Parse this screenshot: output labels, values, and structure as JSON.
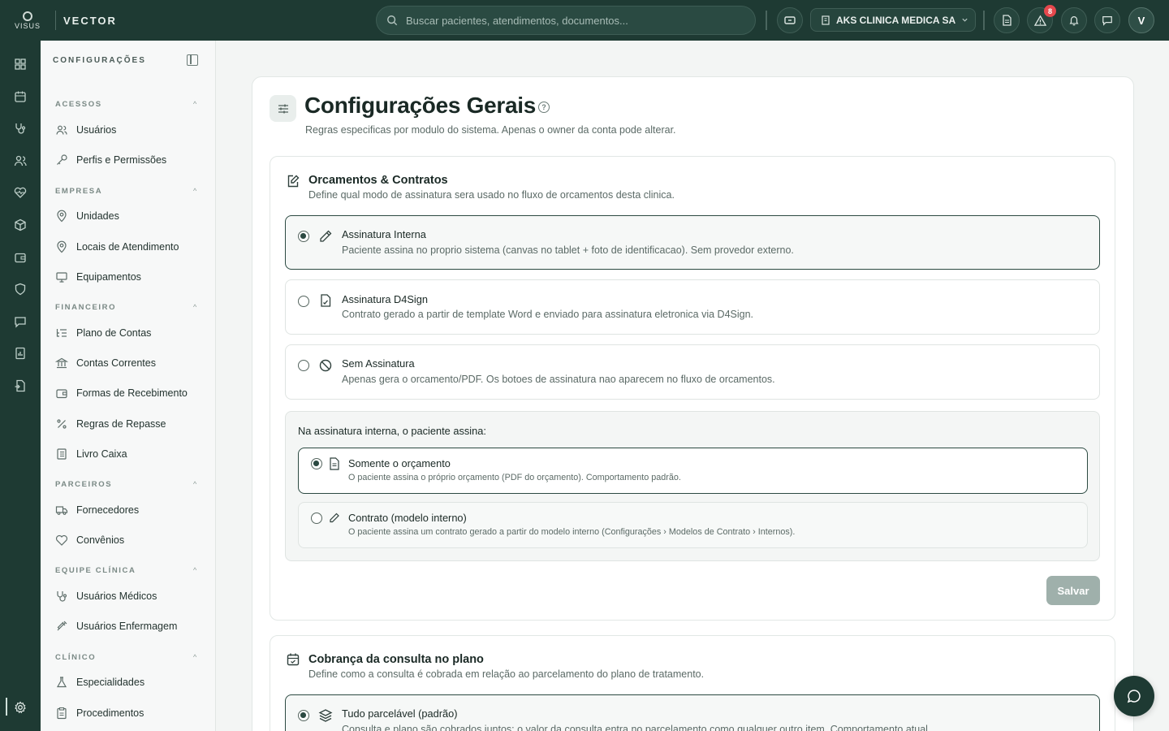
{
  "app": {
    "logo_text": "VISUS",
    "brand": "VECTOR"
  },
  "topbar": {
    "search_placeholder": "Buscar pacientes, atendimentos, documentos...",
    "clinic_name": "AKS CLINICA MEDICA SA",
    "alerts_count": "8",
    "avatar_initial": "V"
  },
  "sidebar": {
    "header": "CONFIGURAÇÕES",
    "sections": {
      "acessos": "ACESSOS",
      "empresa": "EMPRESA",
      "financeiro": "FINANCEIRO",
      "parceiros": "PARCEIROS",
      "equipe": "EQUIPE CLÍNICA",
      "clinico": "CLÍNICO"
    },
    "items": {
      "usuarios": "Usuários",
      "perfis": "Perfis e Permissões",
      "unidades": "Unidades",
      "locais": "Locais de Atendimento",
      "equipamentos": "Equipamentos",
      "plano_contas": "Plano de Contas",
      "contas_correntes": "Contas Correntes",
      "formas_recebimento": "Formas de Recebimento",
      "regras_repasse": "Regras de Repasse",
      "livro_caixa": "Livro Caixa",
      "fornecedores": "Fornecedores",
      "convenios": "Convênios",
      "usuarios_medicos": "Usuários Médicos",
      "usuarios_enfermagem": "Usuários Enfermagem",
      "especialidades": "Especialidades",
      "procedimentos": "Procedimentos"
    }
  },
  "page": {
    "title": "Configurações Gerais",
    "subtitle": "Regras especificas por modulo do sistema. Apenas o owner da conta pode alterar."
  },
  "orcamentos": {
    "title": "Orcamentos & Contratos",
    "desc": "Define qual modo de assinatura sera usado no fluxo de orcamentos desta clinica.",
    "options": [
      {
        "title": "Assinatura Interna",
        "desc": "Paciente assina no proprio sistema (canvas no tablet + foto de identificacao). Sem provedor externo.",
        "selected": true
      },
      {
        "title": "Assinatura D4Sign",
        "desc": "Contrato gerado a partir de template Word e enviado para assinatura eletronica via D4Sign.",
        "selected": false
      },
      {
        "title": "Sem Assinatura",
        "desc": "Apenas gera o orcamento/PDF. Os botoes de assinatura nao aparecem no fluxo de orcamentos.",
        "selected": false
      }
    ],
    "internal": {
      "label": "Na assinatura interna, o paciente assina:",
      "options": [
        {
          "title": "Somente o orçamento",
          "desc": "O paciente assina o próprio orçamento (PDF do orçamento). Comportamento padrão.",
          "selected": true
        },
        {
          "title": "Contrato (modelo interno)",
          "desc": "O paciente assina um contrato gerado a partir do modelo interno (Configurações › Modelos de Contrato › Internos).",
          "selected": false
        }
      ]
    },
    "save_label": "Salvar"
  },
  "cobranca": {
    "title": "Cobrança da consulta no plano",
    "desc": "Define como a consulta é cobrada em relação ao parcelamento do plano de tratamento.",
    "options": [
      {
        "title": "Tudo parcelável (padrão)",
        "desc": "Consulta e plano são cobrados juntos: o valor da consulta entra no parcelamento como qualquer outro item. Comportamento atual.",
        "selected": true
      }
    ]
  },
  "colors": {
    "brand_dark": "#1e3a33",
    "accent": "#2c4a42",
    "alert": "#e5484d",
    "disabled_button": "#9fb0ab"
  }
}
